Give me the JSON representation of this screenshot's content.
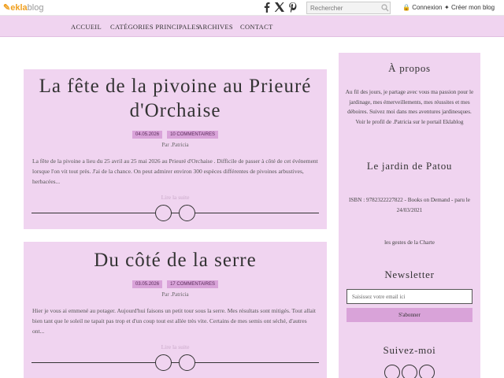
{
  "topbar": {
    "logo_main": "ekla",
    "logo_blog": "blog",
    "search_placeholder": "Rechercher",
    "login": "Connexion",
    "create": "Créer mon blog",
    "social_icons": [
      "facebook-icon",
      "x-icon",
      "pinterest-icon"
    ]
  },
  "nav": {
    "items": [
      "ACCUEIL",
      "CATÉGORIES PRINCIPALES",
      "ARCHIVES",
      "CONTACT"
    ]
  },
  "posts": [
    {
      "title": "La fête de la pivoine au Prieuré d'Orchaise",
      "date": "04.05.2026",
      "comments": "10 COMMENTAIRES",
      "author": "Par .Patricia",
      "excerpt": "La fête de la pivoine a lieu du 25 avril au 25 mai 2026 au Prieuré d'Orchaise . Difficile de passer à côté de cet événement lorsque l'on vit tout près. J'ai de la chance. On peut admirer environ 300 espèces différentes de pivoines arbustives, herbacées...",
      "read_more": "Lire la suite"
    },
    {
      "title": "Du côté de la serre",
      "date": "03.05.2026",
      "comments": "17 COMMENTAIRES",
      "author": "Par .Patricia",
      "excerpt": "Hier je vous ai emmené au potager. Aujourd'hui faisons un petit tour sous la serre. Mes résultats sont mitigés. Tout allait bien tant que le soleil ne tapait pas trop et d'un coup tout est allée très vite. Certains de mes semis ont séché, d'autres ont...",
      "read_more": "Lire la suite"
    }
  ],
  "sidebar": {
    "about_title": "À propos",
    "about_text": "Au fil des jours, je partage avec vous ma passion pour le jardinage, mes émerveillements, mes réussites et mes déboires. Suivez moi dans mes aventures jardinesques.",
    "about_profile": "Voir le profil de .Patricia sur le portail Eklablog",
    "garden_title": "Le jardin de Patou",
    "isbn_text": "ISBN : 9782322227822 - Books on Demand - paru le 24/03/2021",
    "charter_text": "les gestes de la Charte",
    "newsletter_title": "Newsletter",
    "newsletter_placeholder": "Saisissez votre email ici",
    "newsletter_button": "S'abonner",
    "follow_title": "Suivez-moi"
  },
  "colors": {
    "panel": "#f0d4f0",
    "badge": "#d9a3d9",
    "logo": "#f0a020"
  }
}
